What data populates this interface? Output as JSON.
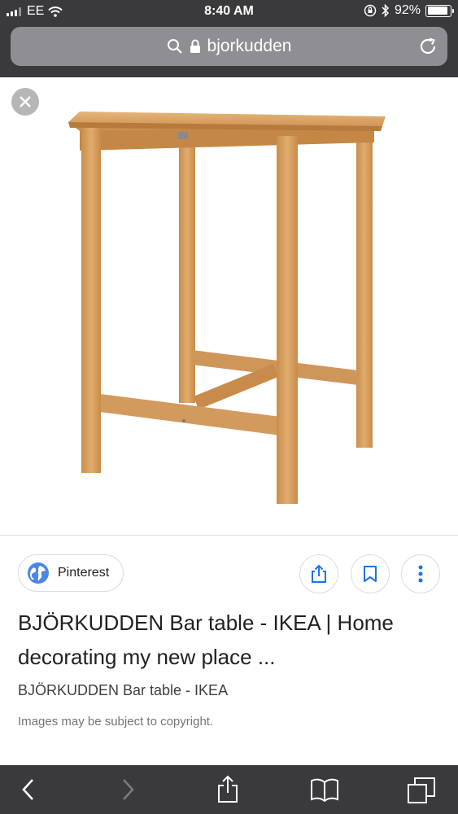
{
  "status_bar": {
    "carrier": "EE",
    "time": "8:40 AM",
    "battery_percent": "92%",
    "battery_level": 0.92
  },
  "browser": {
    "url_text": "bjorkudden",
    "icons": [
      "search-icon",
      "lock-icon",
      "reload-icon"
    ]
  },
  "image_viewer": {
    "close_icon": "close-icon",
    "source": {
      "name": "Pinterest",
      "icon": "globe-icon"
    },
    "actions": [
      "share-icon",
      "bookmark-icon",
      "more-icon"
    ],
    "title": "BJÖRKUDDEN Bar table - IKEA | Home decorating my new place ...",
    "subtitle": "BJÖRKUDDEN Bar table - IKEA",
    "copyright": "Images may be subject to copyright."
  },
  "toolbar": {
    "icons": [
      "back-icon",
      "forward-icon",
      "share-icon",
      "bookmarks-icon",
      "tabs-icon"
    ]
  },
  "colors": {
    "chrome": "#3a3a3c",
    "url_bar": "#8e8e93",
    "accent_blue": "#1a73e8",
    "wood": "#d9a35f"
  }
}
